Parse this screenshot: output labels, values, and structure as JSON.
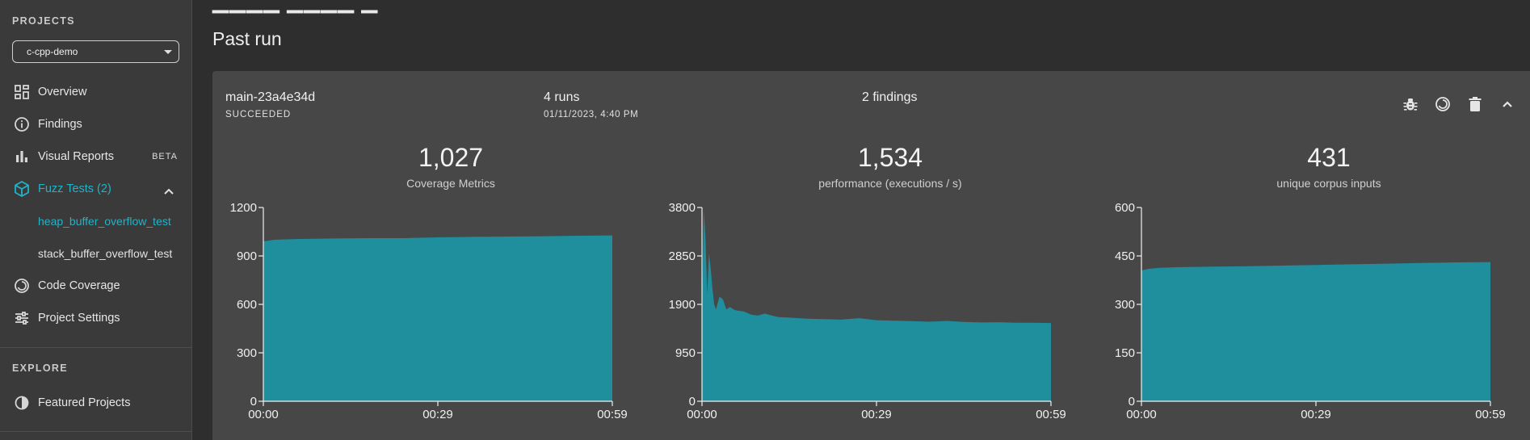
{
  "sidebar": {
    "projects_label": "PROJECTS",
    "project_selected": "c-cpp-demo",
    "items": [
      {
        "label": "Overview",
        "icon": "dashboard-icon"
      },
      {
        "label": "Findings",
        "icon": "info-icon"
      },
      {
        "label": "Visual Reports",
        "icon": "bar-chart-icon",
        "badge": "BETA"
      },
      {
        "label": "Fuzz Tests (2)",
        "icon": "cube-icon",
        "active": true
      },
      {
        "label": "Code Coverage",
        "icon": "coverage-icon"
      },
      {
        "label": "Project Settings",
        "icon": "sliders-icon"
      }
    ],
    "fuzz_tests": [
      {
        "label": "heap_buffer_overflow_test",
        "active": true
      },
      {
        "label": "stack_buffer_overflow_test"
      }
    ],
    "explore_label": "EXPLORE",
    "explore_items": [
      {
        "label": "Featured Projects",
        "icon": "contrast-icon"
      }
    ]
  },
  "main": {
    "title": "Past run",
    "run": {
      "name": "main-23a4e34d",
      "status": "SUCCEEDED",
      "runs": "4 runs",
      "date": "01/11/2023, 4:40 PM",
      "findings": "2 findings",
      "actions": [
        "bug-icon",
        "refresh-icon",
        "delete-icon",
        "chevron-up-icon"
      ]
    }
  },
  "colors": {
    "accent": "#21b3c8",
    "area": "#1f8e9d"
  },
  "chart_data": [
    {
      "type": "area",
      "value_label": "1,027",
      "title": "Coverage Metrics",
      "x_ticks": [
        "00:00",
        "00:29",
        "00:59"
      ],
      "y_ticks": [
        0,
        300,
        600,
        900,
        1200
      ],
      "ylim": [
        0,
        1200
      ],
      "x": [
        0,
        0.03,
        0.1,
        0.2,
        0.3,
        0.4,
        0.5,
        0.6,
        0.7,
        0.8,
        0.9,
        1.0
      ],
      "values": [
        990,
        1000,
        1005,
        1008,
        1010,
        1010,
        1015,
        1018,
        1020,
        1022,
        1025,
        1027
      ]
    },
    {
      "type": "area",
      "value_label": "1,534",
      "title": "performance (executions / s)",
      "x_ticks": [
        "00:00",
        "00:29",
        "00:59"
      ],
      "y_ticks": [
        0,
        950,
        1900,
        2850,
        3800
      ],
      "ylim": [
        0,
        3800
      ],
      "x": [
        0,
        0.005,
        0.01,
        0.015,
        0.02,
        0.025,
        0.03,
        0.035,
        0.04,
        0.05,
        0.06,
        0.07,
        0.08,
        0.09,
        0.1,
        0.12,
        0.14,
        0.16,
        0.18,
        0.2,
        0.22,
        0.25,
        0.3,
        0.35,
        0.4,
        0.45,
        0.5,
        0.55,
        0.6,
        0.65,
        0.7,
        0.75,
        0.8,
        0.85,
        0.9,
        0.95,
        1.0
      ],
      "values": [
        1800,
        3750,
        3200,
        2100,
        2900,
        2600,
        2200,
        1900,
        1800,
        2050,
        2000,
        1800,
        1850,
        1800,
        1780,
        1760,
        1700,
        1680,
        1720,
        1680,
        1650,
        1640,
        1620,
        1610,
        1600,
        1630,
        1590,
        1580,
        1570,
        1560,
        1575,
        1555,
        1545,
        1550,
        1540,
        1540,
        1534
      ]
    },
    {
      "type": "area",
      "value_label": "431",
      "title": "unique corpus inputs",
      "x_ticks": [
        "00:00",
        "00:29",
        "00:59"
      ],
      "y_ticks": [
        0,
        150,
        300,
        450,
        600
      ],
      "ylim": [
        0,
        600
      ],
      "x": [
        0,
        0.02,
        0.05,
        0.1,
        0.2,
        0.3,
        0.4,
        0.5,
        0.6,
        0.7,
        0.8,
        0.9,
        1.0
      ],
      "values": [
        405,
        410,
        413,
        415,
        417,
        418,
        420,
        422,
        424,
        426,
        428,
        430,
        431
      ]
    }
  ]
}
